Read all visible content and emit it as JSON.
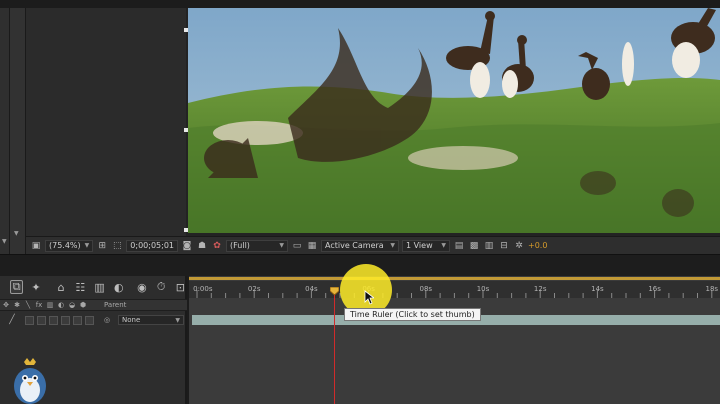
{
  "viewer": {
    "zoom": "(75.4%)",
    "timecode": "0;00;05;01",
    "resolution": "(Full)",
    "camera": "Active Camera",
    "view_layout": "1 View",
    "exposure": "+0.0"
  },
  "timeline": {
    "columns": {
      "parent": "Parent"
    },
    "ruler_ticks": [
      "0:00s",
      "02s",
      "04s",
      "06s",
      "08s",
      "10s",
      "12s",
      "14s",
      "16s",
      "18s"
    ],
    "layer": {
      "parent_value": "None"
    },
    "tooltip": "Time Ruler (Click to set thumb)"
  },
  "colors": {
    "work_area": "#c29a36",
    "current_time_indicator": "#d02b2b",
    "layer_bar": "#96aeaa",
    "highlight": "#ffec28"
  }
}
